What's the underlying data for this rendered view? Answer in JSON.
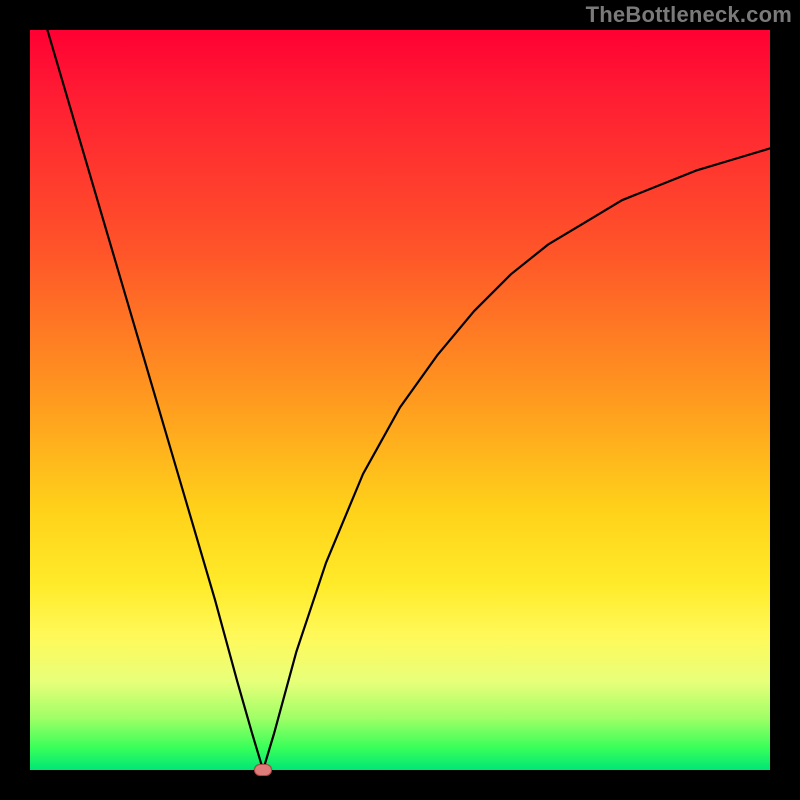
{
  "watermark": "TheBottleneck.com",
  "chart_data": {
    "type": "line",
    "title": "",
    "xlabel": "",
    "ylabel": "",
    "xlim": [
      0,
      100
    ],
    "ylim": [
      0,
      100
    ],
    "legend": false,
    "grid": false,
    "series": [
      {
        "name": "bottleneck-curve",
        "x": [
          0,
          5,
          10,
          15,
          20,
          25,
          28,
          30,
          31.5,
          33,
          36,
          40,
          45,
          50,
          55,
          60,
          65,
          70,
          75,
          80,
          85,
          90,
          95,
          100
        ],
        "values": [
          108,
          91,
          74,
          57,
          40,
          23,
          12,
          5,
          0,
          5,
          16,
          28,
          40,
          49,
          56,
          62,
          67,
          71,
          74,
          77,
          79,
          81,
          82.5,
          84
        ]
      }
    ],
    "marker": {
      "x": 31.5,
      "y": 0
    },
    "background_gradient": {
      "top": "#ff0033",
      "bottom": "#00e676"
    },
    "colors": {
      "curve": "#000000",
      "marker_fill": "#de7b7b",
      "frame": "#000000",
      "watermark": "#7a7a7a"
    }
  }
}
